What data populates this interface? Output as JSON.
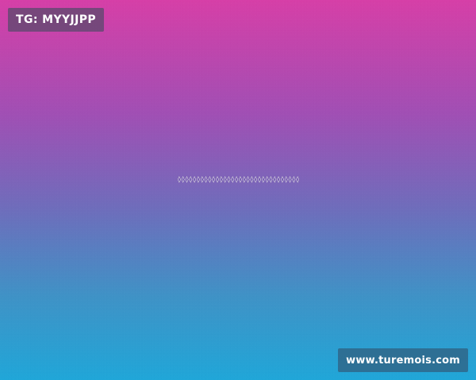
{
  "top_badge": {
    "label": "TG: MYYJJPP"
  },
  "center": {
    "text": "◊◊◊◊◊◊◊◊◊◊◊◊◊◊◊◊◊◊◊◊◊◊◊◊◊◊◊◊◊◊◊◊◊◊◊◊◊◊◊◊◊◊◊◊"
  },
  "bottom_badge": {
    "label": "www.turemois.com"
  },
  "colors": {
    "gradient_top": "#d63fa7",
    "gradient_bottom": "#20a6d8"
  }
}
